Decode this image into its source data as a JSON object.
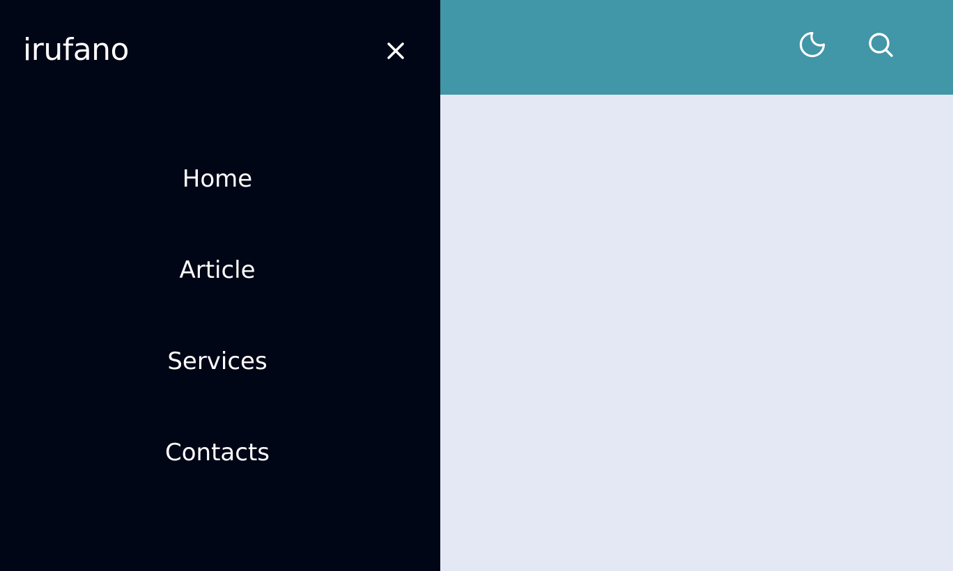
{
  "brand": {
    "logo_text": "irufano"
  },
  "drawer": {
    "close_icon": "close-icon",
    "nav_items": [
      {
        "label": "Home"
      },
      {
        "label": "Article"
      },
      {
        "label": "Services"
      },
      {
        "label": "Contacts"
      }
    ]
  },
  "header": {
    "theme_toggle_icon": "moon-icon",
    "search_icon": "search-icon"
  },
  "colors": {
    "header_bg": "#4196a7",
    "drawer_bg": "#000616",
    "page_bg": "#e4e8f4",
    "text_on_dark": "#ffffff"
  }
}
